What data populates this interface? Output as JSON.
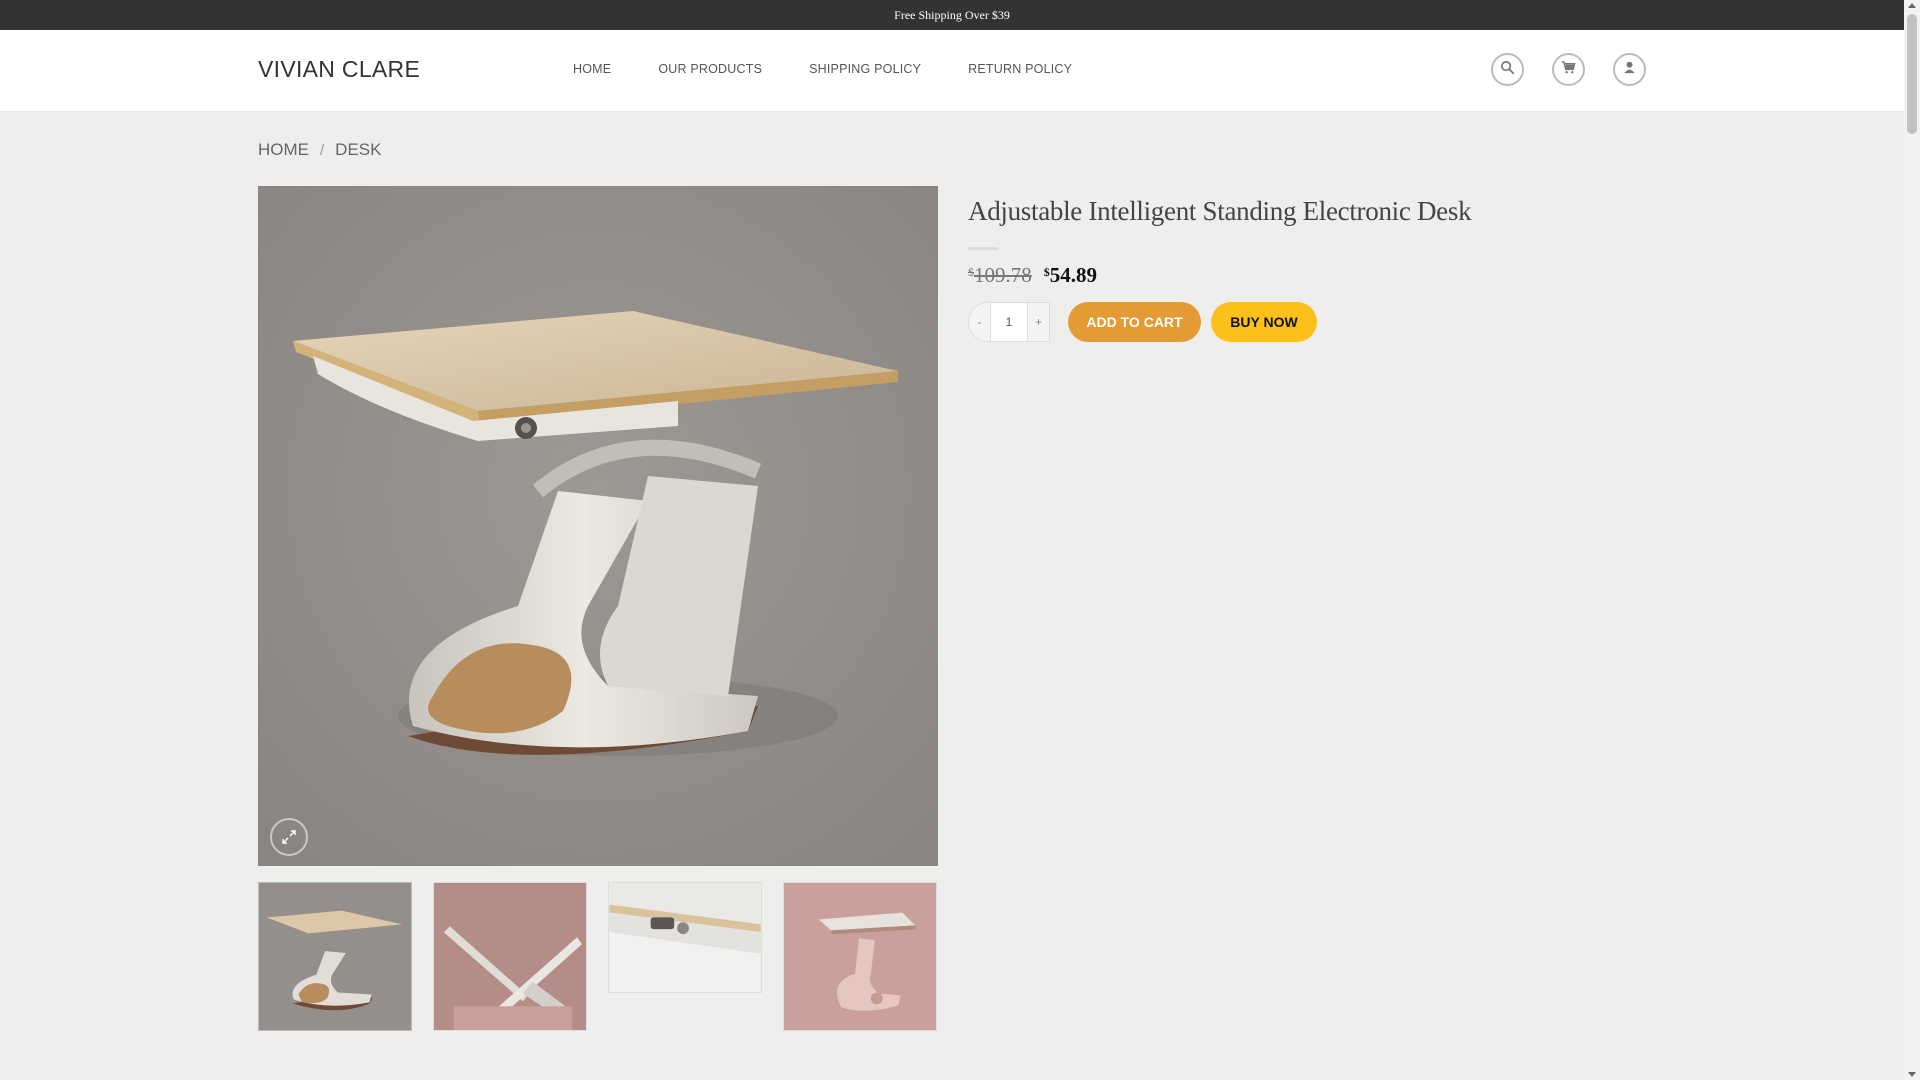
{
  "topbar": {
    "text": "Free Shipping Over $39"
  },
  "header": {
    "logo": "VIVIAN CLARE",
    "nav": [
      {
        "label": "HOME"
      },
      {
        "label": "OUR PRODUCTS"
      },
      {
        "label": "SHIPPING POLICY"
      },
      {
        "label": "RETURN POLICY"
      }
    ],
    "icons": [
      "search-icon",
      "cart-icon",
      "user-icon"
    ]
  },
  "breadcrumb": {
    "home": "HOME",
    "separator": "/",
    "current": "DESK"
  },
  "product": {
    "title": "Adjustable Intelligent Standing Electronic Desk",
    "currency": "$",
    "price_old": "109.78",
    "price_new": "54.89",
    "quantity": "1",
    "qty_minus": "-",
    "qty_plus": "+",
    "add_to_cart": "ADD TO CART",
    "buy_now": "BUY NOW"
  },
  "gallery": {
    "thumbnails": [
      "desk-front-view",
      "desk-tilted-top-view",
      "desk-edge-detail-view",
      "desk-pink-variant-view"
    ],
    "zoom_icon": "expand-icon"
  },
  "colors": {
    "topbar_bg": "#333333",
    "add_to_cart_bg": "#e39b35",
    "buy_now_bg": "#fcc01b",
    "page_bg": "#eeeeec"
  }
}
